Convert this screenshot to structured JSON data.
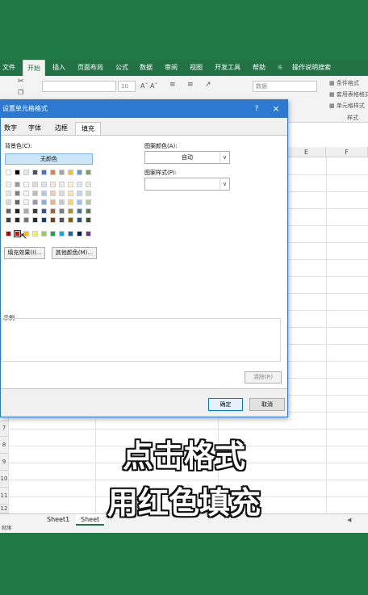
{
  "ribbon": {
    "tabs": [
      "文件",
      "开始",
      "插入",
      "页面布局",
      "公式",
      "数据",
      "审阅",
      "视图",
      "开发工具",
      "帮助",
      "操作说明搜索"
    ],
    "active_tab": "开始",
    "font_size": "10",
    "number_format": "数据",
    "styles_items": [
      "条件格式",
      "套用表格格式",
      "单元格样式"
    ],
    "styles_group": "样式"
  },
  "sheet": {
    "col_headers": [
      "E",
      "F"
    ],
    "row_headers": [
      "7",
      "8",
      "9",
      "10",
      "11",
      "12"
    ],
    "tabs": [
      "Sheet1",
      "Sheet"
    ],
    "status": "就绪"
  },
  "dialog": {
    "title": "设置单元格格式",
    "help": "?",
    "close": "×",
    "tabs": [
      "数字",
      "字体",
      "边框",
      "填充"
    ],
    "active_tab": "填充",
    "background_label": "背景色(C):",
    "no_color": "无颜色",
    "fill_effects": "填充效果(I)...",
    "more_colors": "其他颜色(M)...",
    "pattern_color_label": "图案颜色(A):",
    "pattern_color_value": "自动",
    "pattern_style_label": "图案样式(P):",
    "sample_label": "示例",
    "clear": "清除(R)",
    "ok": "确定",
    "cancel": "取消",
    "colors": {
      "theme_row": [
        "#ffffff",
        "#000000",
        "#e7e6e6",
        "#44546a",
        "#4472c4",
        "#ed7d31",
        "#a5a5a5",
        "#ffc000",
        "#5b9bd5",
        "#70ad47"
      ],
      "standard_row": [
        "#c00000",
        "#ff0000",
        "#ffc000",
        "#ffff00",
        "#92d050",
        "#00b050",
        "#00b0f0",
        "#0070c0",
        "#002060",
        "#7030a0"
      ],
      "selected": "#ff0000"
    }
  },
  "caption": {
    "line1": "点击格式",
    "line2": "用红色填充"
  }
}
